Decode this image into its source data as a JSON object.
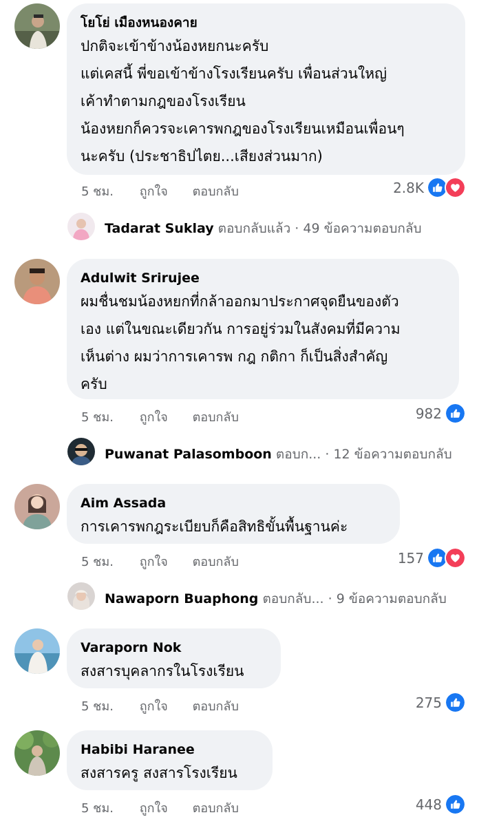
{
  "comments": [
    {
      "author": "โยโย่ เมืองหนองคาย",
      "lines": [
        "ปกติจะเข้าข้างน้องหยกนะครับ",
        "แต่เคสนี้ พี่ขอเข้าข้างโรงเรียนครับ เพื่อนส่วนใหญ่",
        "เค้าทำตามกฎของโรงเรียน",
        "น้องหยกก็ควรจะเคารพกฎของโรงเรียนเหมือนเพื่อนๆ",
        "นะครับ  (ประชาธิปไตย...เสียงส่วนมาก)"
      ],
      "time": "5 ชม.",
      "like_label": "ถูกใจ",
      "reply_label": "ตอบกลับ",
      "reaction_count": "2.8K",
      "reactions": [
        "like-icon",
        "love-icon"
      ],
      "replies": {
        "name": "Tadarat Suklay",
        "action": "ตอบกลับแล้ว",
        "count": "· 49 ข้อความตอบกลับ"
      }
    },
    {
      "author": "Adulwit Srirujee",
      "lines": [
        "ผมชื่นชมน้องหยกที่กล้าออกมาประกาศจุดยืนของตัว",
        "เอง แต่ในขณะเดียวกัน การอยู่ร่วมในสังคมที่มีความ",
        "เห็นต่าง ผมว่าการเคารพ กฎ กติกา ก็เป็นสิ่งสำคัญ",
        "ครับ"
      ],
      "time": "5 ชม.",
      "like_label": "ถูกใจ",
      "reply_label": "ตอบกลับ",
      "reaction_count": "982",
      "reactions": [
        "like-icon"
      ],
      "replies": {
        "name": "Puwanat Palasomboon",
        "action": "ตอบก...",
        "count": "· 12 ข้อความตอบกลับ"
      }
    },
    {
      "author": "Aim Assada",
      "lines": [
        "การเคารพกฎระเบียบก็คือสิทธิขั้นพื้นฐานค่ะ"
      ],
      "time": "5 ชม.",
      "like_label": "ถูกใจ",
      "reply_label": "ตอบกลับ",
      "reaction_count": "157",
      "reactions": [
        "like-icon",
        "love-icon"
      ],
      "replies": {
        "name": "Nawaporn Buaphong",
        "action": "ตอบกลับ...",
        "count": "· 9 ข้อความตอบกลับ"
      }
    },
    {
      "author": "Varaporn Nok",
      "lines": [
        "สงสารบุคลากรในโรงเรียน"
      ],
      "time": "5 ชม.",
      "like_label": "ถูกใจ",
      "reply_label": "ตอบกลับ",
      "reaction_count": "275",
      "reactions": [
        "like-icon"
      ]
    },
    {
      "author": "Habibi Haranee",
      "lines": [
        "สงสารครู สงสารโรงเรียน"
      ],
      "time": "5 ชม.",
      "like_label": "ถูกใจ",
      "reply_label": "ตอบกลับ",
      "reaction_count": "448",
      "reactions": [
        "like-icon"
      ]
    }
  ],
  "colors": {
    "bubble": "#f0f2f5",
    "meta_text": "#65676b",
    "like_blue": "#1877f2",
    "love_red": "#f33e58"
  }
}
